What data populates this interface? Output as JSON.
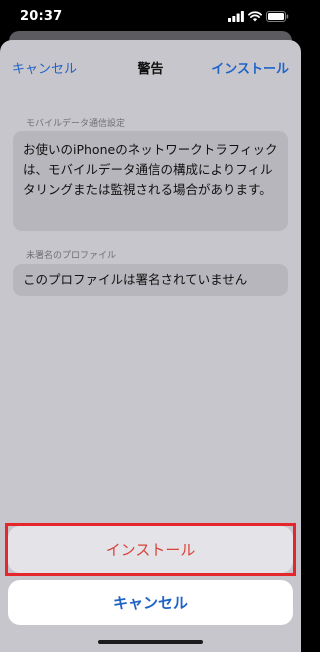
{
  "status_bar": {
    "time": "20:37",
    "icons": [
      "signal-icon",
      "wifi-icon",
      "battery-icon"
    ]
  },
  "nav": {
    "cancel_label": "キャンセル",
    "title": "警告",
    "install_label": "インストール"
  },
  "sections": [
    {
      "label": "モバイルデータ通信設定",
      "text": "お使いのiPhoneのネットワークトラフィックは、モバイルデータ通信の構成によりフィルタリングまたは監視される場合があります。"
    },
    {
      "label": "未署名のプロファイル",
      "text": "このプロファイルは署名されていません"
    }
  ],
  "action_sheet": {
    "install_label": "インストール",
    "cancel_label": "キャンセル"
  },
  "colors": {
    "accent": "#1f63c7",
    "destructive": "#d8433a",
    "highlight": "#e5262b"
  }
}
